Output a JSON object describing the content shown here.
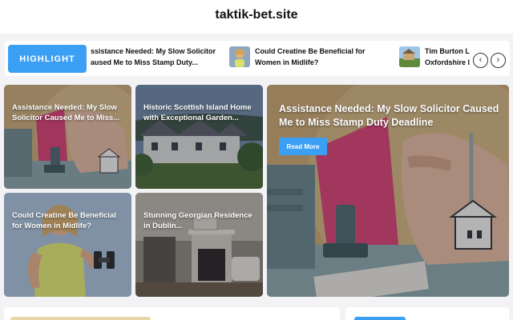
{
  "site": {
    "title": "taktik-bet.site"
  },
  "ticker": {
    "label": "HIGHLIGHT",
    "items": [
      {
        "line1": "ssistance Needed: My Slow Solicitor",
        "line2": "aused Me to Miss Stamp Duty..."
      },
      {
        "line1": "Could Creatine Be Beneficial for",
        "line2": "Women in Midlife?"
      },
      {
        "line1": "Tim Burton L",
        "line2": "Oxfordshire I"
      }
    ],
    "prev_icon": "chevron-left-icon",
    "next_icon": "chevron-right-icon"
  },
  "cards": [
    {
      "title": "Assistance Needed: My Slow Solicitor Caused Me to Miss..."
    },
    {
      "title": "Historic Scottish Island Home with Exceptional Garden..."
    },
    {
      "title": "Could Creatine Be Beneficial for Women in Midlife?"
    },
    {
      "title": "Stunning Georgian Residence in Dublin..."
    }
  ],
  "featured": {
    "title": "Assistance Needed: My Slow Solicitor Caused Me to Miss Stamp Duty Deadline",
    "button": "Read More"
  },
  "colors": {
    "accent": "#3b9ff3"
  }
}
